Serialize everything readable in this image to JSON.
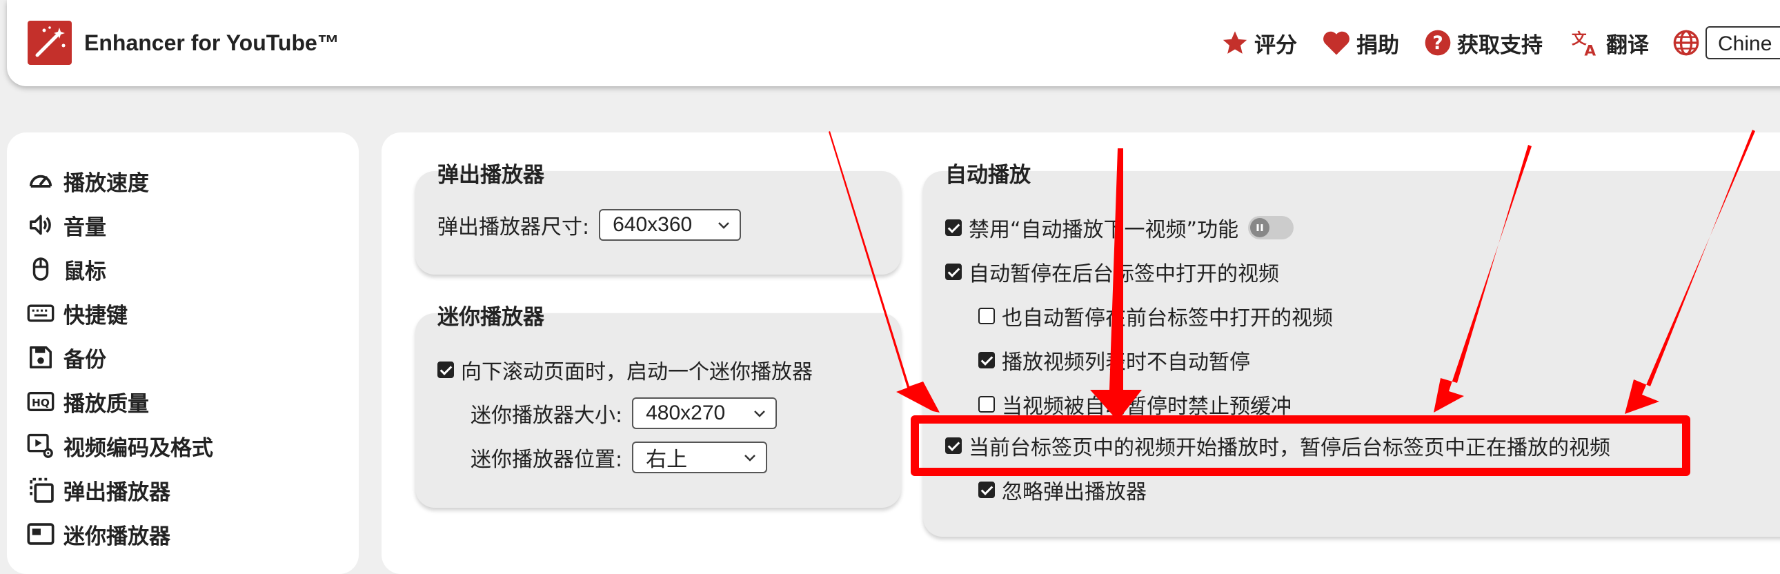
{
  "header": {
    "app_title": "Enhancer for YouTube™",
    "links": {
      "rate": "评分",
      "donate": "捐助",
      "support": "获取支持",
      "translate": "翻译"
    },
    "language_value": "Chine"
  },
  "sidebar": {
    "items": [
      {
        "label": "播放速度",
        "icon": "speedometer-icon"
      },
      {
        "label": "音量",
        "icon": "volume-icon"
      },
      {
        "label": "鼠标",
        "icon": "mouse-icon"
      },
      {
        "label": "快捷键",
        "icon": "keyboard-icon"
      },
      {
        "label": "备份",
        "icon": "floppy-disk-icon"
      },
      {
        "label": "播放质量",
        "icon": "hq-icon"
      },
      {
        "label": "视频编码及格式",
        "icon": "video-settings-icon"
      },
      {
        "label": "弹出播放器",
        "icon": "popout-icon"
      },
      {
        "label": "迷你播放器",
        "icon": "mini-player-icon"
      }
    ]
  },
  "popup_player": {
    "title": "弹出播放器",
    "size_label": "弹出播放器尺寸:",
    "size_value": "640x360"
  },
  "mini_player": {
    "title": "迷你播放器",
    "enable_label": "向下滚动页面时，启动一个迷你播放器",
    "enable_checked": true,
    "size_label": "迷你播放器大小:",
    "size_value": "480x270",
    "position_label": "迷你播放器位置:",
    "position_value": "右上"
  },
  "autoplay": {
    "title": "自动播放",
    "options": [
      {
        "label": "禁用“自动播放下一视频”功能",
        "checked": true,
        "level": 0,
        "toggle": true
      },
      {
        "label": "自动暂停在后台标签中打开的视频",
        "checked": true,
        "level": 0
      },
      {
        "label": "也自动暂停在前台标签中打开的视频",
        "checked": false,
        "level": 1
      },
      {
        "label": "播放视频列表时不自动暂停",
        "checked": true,
        "level": 1
      },
      {
        "label": "当视频被自动暂停时禁止预缓冲",
        "checked": false,
        "level": 1
      },
      {
        "label": "当前台标签页中的视频开始播放时，暂停后台标签页中正在播放的视频",
        "checked": true,
        "level": 0,
        "highlighted": true
      },
      {
        "label": "忽略弹出播放器",
        "checked": true,
        "level": 1
      }
    ]
  },
  "colors": {
    "brand": "#c4302b",
    "highlight": "#ff0000",
    "background": "#efefef"
  }
}
